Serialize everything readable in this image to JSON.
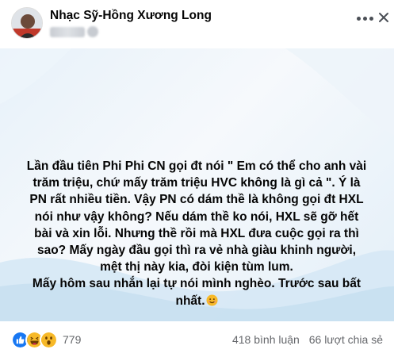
{
  "post": {
    "author": "Nhạc Sỹ-Hồng Xương Long",
    "text": "Lần đầu tiên Phi Phi CN gọi đt nói \" Em có thể cho anh vài\ntrăm triệu, chứ mấy trăm triệu HVC không là gì cả \". Ý là\nPN rất nhiều tiền. Vậy PN có dám thề là không gọi đt HXL\nnói như vậy không? Nếu dám thề ko nói, HXL sẽ gỡ hết\nbài và xin lỗi. Nhưng thề rồi mà HXL đưa cuộc gọi ra thì\nsao? Mấy ngày đầu gọi thì ra vẻ nhà giàu khinh người,\nmệt thị này kia, đòi kiện tùm lum.\nMấy hôm sau nhắn lại tự nói mình nghèo. Trước sau bất\nnhất.",
    "trailing_emoji": "smiling-face-icon"
  },
  "footer": {
    "reaction_icons": [
      "like-icon",
      "haha-icon",
      "wow-icon"
    ],
    "reaction_count": "779",
    "comments": "418 bình luận",
    "shares": "66 lượt chia sẻ"
  },
  "colors": {
    "like": "#1877f2",
    "emoji": "#f7b928",
    "text_secondary": "#65676b",
    "background_wave": "#cfe3f3"
  }
}
